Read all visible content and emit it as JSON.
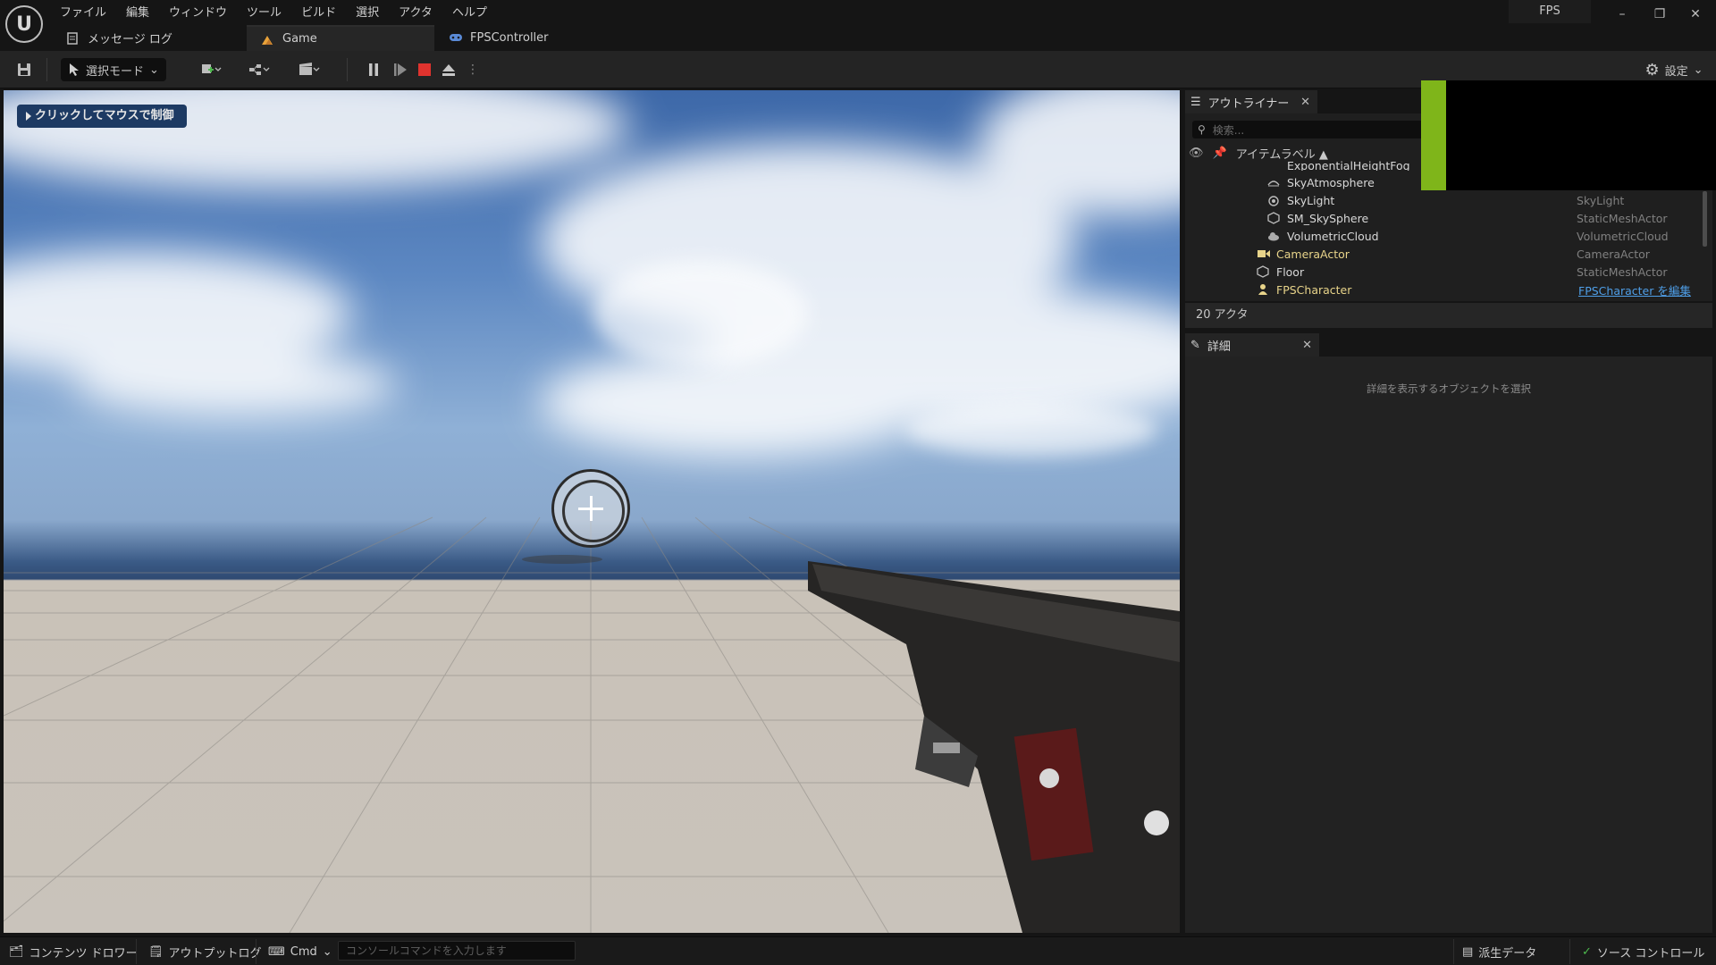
{
  "menu": [
    "ファイル",
    "編集",
    "ウィンドウ",
    "ツール",
    "ビルド",
    "選択",
    "アクタ",
    "ヘルプ"
  ],
  "project_name": "FPS",
  "window_controls": {
    "minimize": "–",
    "restore": "❐",
    "close": "✕"
  },
  "tabs": [
    {
      "label": "メッセージ ログ"
    },
    {
      "label": "Game"
    },
    {
      "label": "FPSController"
    }
  ],
  "toolbar": {
    "select_mode": "選択モード",
    "settings": "設定"
  },
  "viewport": {
    "click_hint": "クリックしてマウスで制御"
  },
  "outliner": {
    "title": "アウトライナー",
    "search_placeholder": "検索...",
    "column_label": "アイテムラベル ▲",
    "rows": [
      {
        "name": "ExponentialHeightFog",
        "type": ""
      },
      {
        "name": "SkyAtmosphere",
        "type": ""
      },
      {
        "name": "SkyLight",
        "type": "SkyLight"
      },
      {
        "name": "SM_SkySphere",
        "type": "StaticMeshActor"
      },
      {
        "name": "VolumetricCloud",
        "type": "VolumetricCloud"
      },
      {
        "name": "CameraActor",
        "type": "CameraActor"
      },
      {
        "name": "Floor",
        "type": "StaticMeshActor"
      },
      {
        "name": "FPSCharacter",
        "type": "FPSCharacter を編集"
      }
    ],
    "actor_count": "20 アクタ"
  },
  "details": {
    "title": "詳細",
    "empty_message": "詳細を表示するオブジェクトを選択"
  },
  "statusbar": {
    "content_drawer": "コンテンツ ドロワー",
    "output_log": "アウトプットログ",
    "cmd": "Cmd",
    "console_placeholder": "コンソールコマンドを入力します",
    "derived_data": "派生データ",
    "source_control": "ソース コントロール"
  },
  "colors": {
    "accent_green": "#7fb51a",
    "link_blue": "#4f9fe8",
    "stop_red": "#e0332e"
  }
}
